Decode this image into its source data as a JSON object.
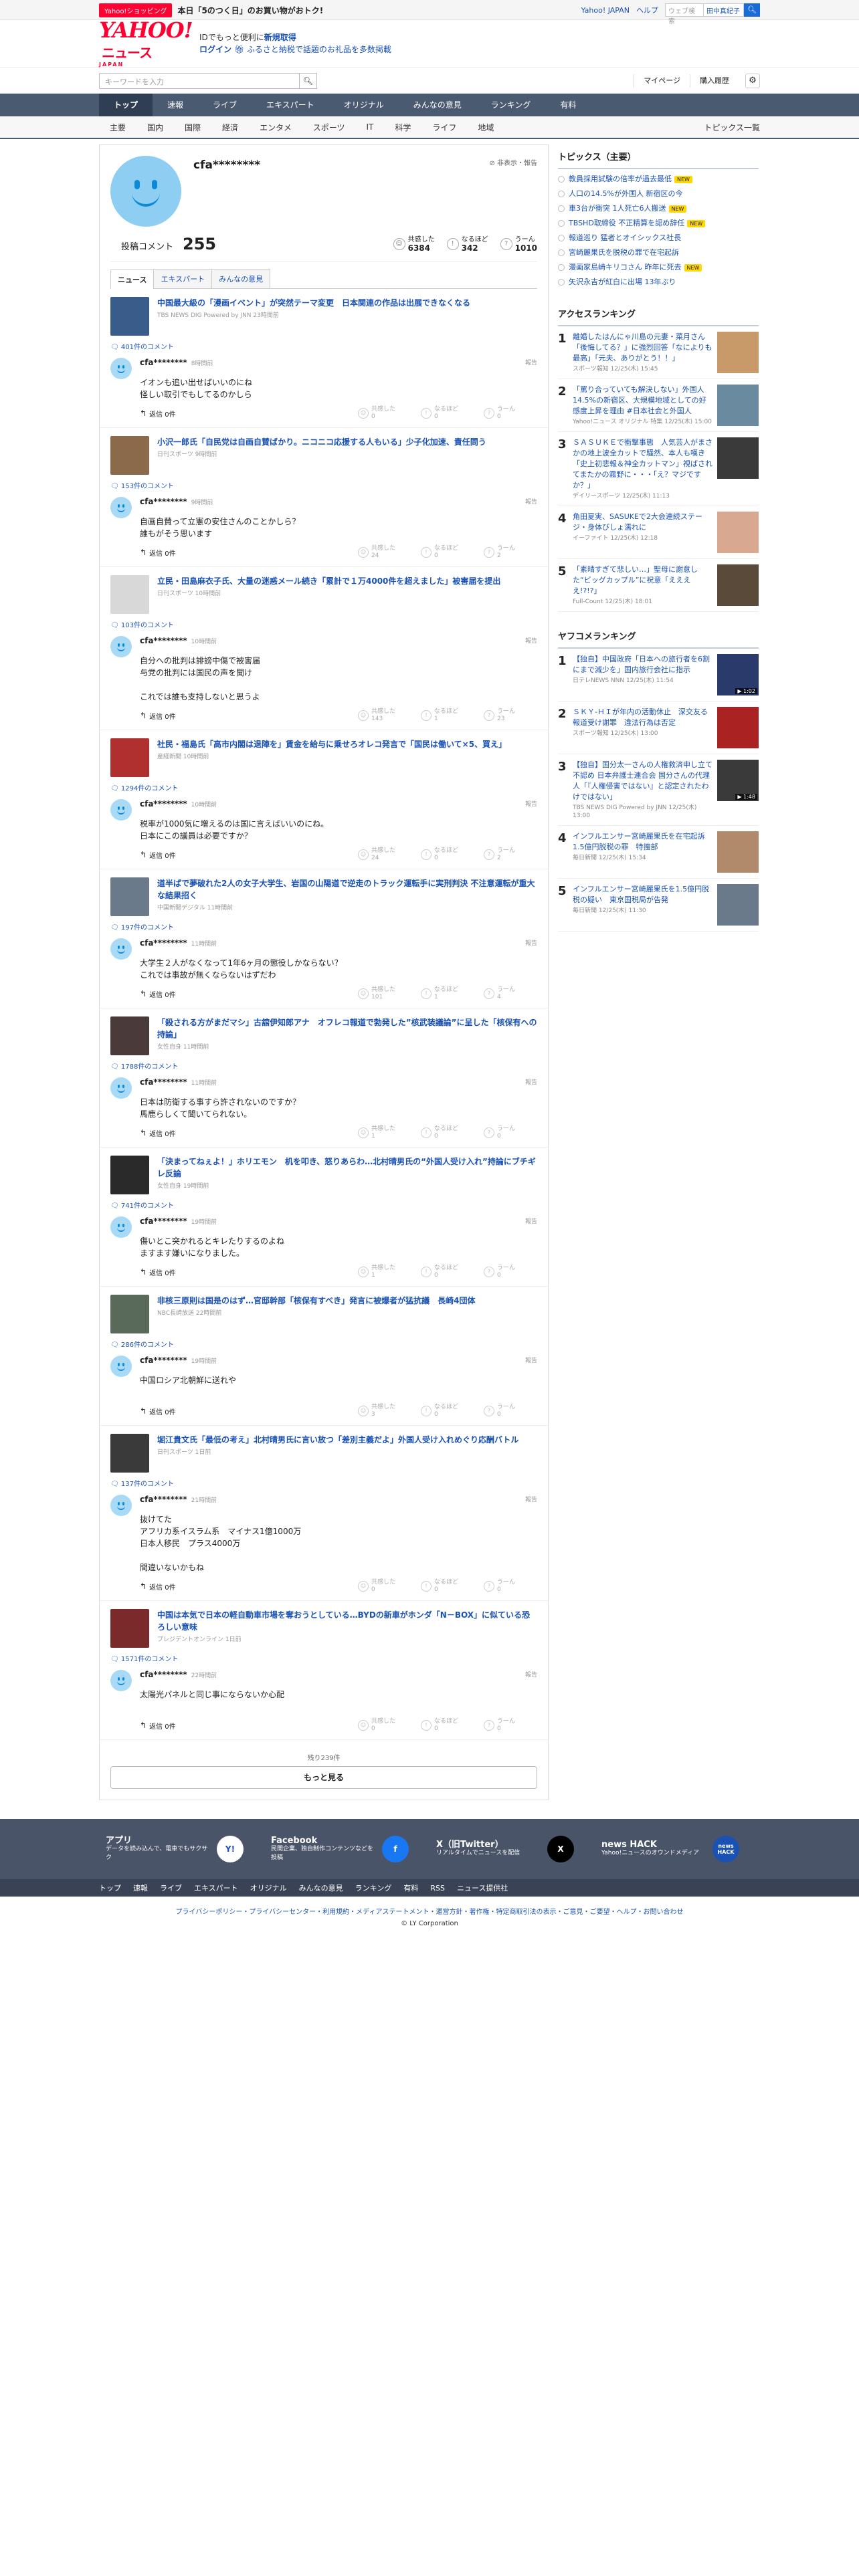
{
  "topbar": {
    "shop_badge": "Yahoo!ショッピング",
    "shop_text": "本日「5のつく日」のお買い物がおトク!",
    "links": [
      "Yahoo! JAPAN",
      "ヘルプ"
    ],
    "search_placeholder": "ウェブ検索",
    "user_name": "田中真紀子"
  },
  "header": {
    "logo": "YAHOO!",
    "logo_sub": "ニュース",
    "logo_jp": "JAPAN",
    "line1_prefix": "IDでもっと便利に",
    "line1_link": "新規取得",
    "line2_login": "ログイン",
    "line2_text": "ふるさと納税で話題のお礼品を多数掲載"
  },
  "searchrow": {
    "placeholder": "キーワードを入力",
    "mypage": "マイページ",
    "history": "購入履歴"
  },
  "nav1": [
    "トップ",
    "速報",
    "ライブ",
    "エキスパート",
    "オリジナル",
    "みんなの意見",
    "ランキング",
    "有料"
  ],
  "nav2": [
    "主要",
    "国内",
    "国際",
    "経済",
    "エンタメ",
    "スポーツ",
    "IT",
    "科学",
    "ライフ",
    "地域"
  ],
  "nav2_right": "トピックス一覧",
  "profile": {
    "name": "cfa********",
    "nonpublic": "非表示・報告",
    "label": "投稿コメント",
    "count": "255",
    "reactions": [
      {
        "icon": "thumb",
        "label": "共感した",
        "value": "6384"
      },
      {
        "icon": "lightbulb",
        "label": "なるほど",
        "value": "342"
      },
      {
        "icon": "hmm",
        "label": "うーん",
        "value": "1010"
      }
    ],
    "tabs": [
      "ニュース",
      "エキスパート",
      "みんなの意見"
    ]
  },
  "reply_label": "返信 0件",
  "report_label": "報告",
  "items": [
    {
      "title": "中国最大級の「漫画イベント」が突然テーマ変更　日本関連の作品は出展できなくなる",
      "source": "TBS NEWS DIG Powered by JNN 23時間前",
      "comments": "401件のコメント",
      "user": "cfa********",
      "time": "8時間前",
      "text": "イオンも追い出せばいいのにね\n怪しい取引でもしてるのかしら",
      "r": [
        "共感した\n0",
        "なるほど\n0",
        "うーん\n0"
      ],
      "thumb": "#3a5c8a"
    },
    {
      "title": "小沢一郎氏「自民党は自画自賛ばかり。ニコニコ応援する人もいる」少子化加速、責任問う",
      "source": "日刊スポーツ 9時間前",
      "comments": "153件のコメント",
      "user": "cfa********",
      "time": "9時間前",
      "text": "自画自賛って立憲の安住さんのことかしら？\n誰もがそう思います",
      "r": [
        "共感した\n24",
        "なるほど\n0",
        "うーん\n2"
      ],
      "thumb": "#8a6a4a"
    },
    {
      "title": "立民・田島麻衣子氏、大量の迷惑メール続き「累計で１万4000件を超えました」被害届を提出",
      "source": "日刊スポーツ 10時間前",
      "comments": "103件のコメント",
      "user": "cfa********",
      "time": "10時間前",
      "text": "自分への批判は誹謗中傷で被害届\n与党の批判には国民の声を聞け\n\nこれでは誰も支持しないと思うよ",
      "r": [
        "共感した\n143",
        "なるほど\n1",
        "うーん\n23"
      ],
      "thumb": "#d8d8d8"
    },
    {
      "title": "社民・福島氏「高市内閣は退陣を」賃金を給与に乗せろオレコ発言で「国民は働いて×5、買え」",
      "source": "産経新聞 10時間前",
      "comments": "1294件のコメント",
      "user": "cfa********",
      "time": "10時間前",
      "text": "税率が1000気に増えるのは国に言えばいいのにね。\n日本にこの議員は必要ですか？",
      "r": [
        "共感した\n24",
        "なるほど\n0",
        "うーん\n2"
      ],
      "thumb": "#b03030"
    },
    {
      "title": "道半ばで夢破れた2人の女子大学生、岩国の山陽道で逆走のトラック運転手に実刑判決 不注意運転が重大な結果招く",
      "source": "中国新聞デジタル 11時間前",
      "comments": "197件のコメント",
      "user": "cfa********",
      "time": "11時間前",
      "text": "大学生２人がなくなって1年6ヶ月の懲役しかならない？\nこれでは事故が無くならないはずだわ",
      "r": [
        "共感した\n101",
        "なるほど\n1",
        "うーん\n4"
      ],
      "thumb": "#6a7a8a"
    },
    {
      "title": "「殺される方がまだマシ」古舘伊知郎アナ　オフレコ報道で勃発した”核武装議論”に呈した「核保有への持論」",
      "source": "女性自身 11時間前",
      "comments": "1788件のコメント",
      "user": "cfa********",
      "time": "11時間前",
      "text": "日本は防衛する事すら許されないのですか？\n馬鹿らしくて聞いてられない。",
      "r": [
        "共感した\n1",
        "なるほど\n0",
        "うーん\n0"
      ],
      "thumb": "#4a3a3a"
    },
    {
      "title": "「決まってねぇよ！」ホリエモン　机を叩き、怒りあらわ…北村晴男氏の“外国人受け入れ”持論にブチギレ反論",
      "source": "女性自身 19時間前",
      "comments": "741件のコメント",
      "user": "cfa********",
      "time": "19時間前",
      "text": "傷いとこ突かれるとキレたりするのよね\nますます嫌いになりました。",
      "r": [
        "共感した\n1",
        "なるほど\n0",
        "うーん\n0"
      ],
      "thumb": "#2a2a2a"
    },
    {
      "title": "非核三原則は国是のはず…官邸幹部「核保有すべき」発言に被爆者が猛抗議　長崎4団体",
      "source": "NBC長崎放送 22時間前",
      "comments": "286件のコメント",
      "user": "cfa********",
      "time": "19時間前",
      "text": "中国ロシア北朝鮮に送れや",
      "r": [
        "共感した\n3",
        "なるほど\n0",
        "うーん\n0"
      ],
      "thumb": "#5a6a5a"
    },
    {
      "title": "堀江貴文氏「最低の考え」北村晴男氏に言い放つ「差別主義だよ」外国人受け入れめぐり応酬バトル",
      "source": "日刊スポーツ 1日前",
      "comments": "137件のコメント",
      "user": "cfa********",
      "time": "21時間前",
      "text": "抜けてた\nアフリカ系イスラム系　マイナス1億1000万\n日本人移民　プラス4000万\n\n間違いないかもね",
      "r": [
        "共感した\n0",
        "なるほど\n0",
        "うーん\n0"
      ],
      "thumb": "#3a3a3a"
    },
    {
      "title": "中国は本気で日本の軽自動車市場を奪おうとしている…BYDの新車がホンダ「N－BOX」に似ている恐ろしい意味",
      "source": "プレジデントオンライン 1日前",
      "comments": "1571件のコメント",
      "user": "cfa********",
      "time": "22時間前",
      "text": "太陽光パネルと同じ事にならないか心配",
      "r": [
        "共感した\n0",
        "なるほど\n0",
        "うーん\n0"
      ],
      "thumb": "#7a2a2a"
    }
  ],
  "remain": "残り239件",
  "more": "もっと見る",
  "right": {
    "topics_title": "トピックス（主要）",
    "topics": [
      {
        "t": "教員採用試験の倍率が過去最低",
        "new": true
      },
      {
        "t": "人口の14.5%が外国人 新宿区の今",
        "new": false
      },
      {
        "t": "車3台が衝突 1人死亡6人搬送",
        "new": true
      },
      {
        "t": "TBSHD取締役 不正精算を認め辞任",
        "new": true
      },
      {
        "t": "報道巡り 猛者とオイシックス社長",
        "new": false
      },
      {
        "t": "宮崎麗果氏を脱税の罪で在宅起訴",
        "new": false
      },
      {
        "t": "漫画家島崎キリコさん 昨年に死去",
        "new": true
      },
      {
        "t": "矢沢永吉が紅白に出場 13年ぶり",
        "new": false
      }
    ],
    "access_title": "アクセスランキング",
    "access": [
      {
        "n": "1",
        "t": "離婚したはんにゃ川島の元妻・菜月さん「後悔してる？」に強烈回答「なによりも最高」「元夫、ありがとう！！」",
        "s": "スポーツ報知 12/25(木) 15:45",
        "c": "#c89a6a"
      },
      {
        "n": "2",
        "t": "「罵り合っていても解決しない」外国人14.5%の新宿区、大規模地域としての好感度上昇を理由 #日本社会と外国人",
        "s": "Yahoo!ニュース オリジナル 特集 12/25(木) 15:00",
        "c": "#6a8aa0"
      },
      {
        "n": "3",
        "t": "ＳＡＳＵＫＥで衝撃事態　人気芸人がまさかの地上波全カットで騒然、本人も嘆き「史上初悲報＆神全カットマン」視ばされてまたかの霧野に・・・「え？マジですか？」",
        "s": "デイリースポーツ 12/25(木) 11:13",
        "c": "#3a3a3a"
      },
      {
        "n": "4",
        "t": "角田夏実、SASUKEで2大会連続ステージ・身体びしょ濡れに",
        "s": "イーファイト 12/25(木) 12:18",
        "c": "#d8a890"
      },
      {
        "n": "5",
        "t": "「素晴すぎて悲しい…」聖母に謝意した“ビッグカップル”に祝意「ええええ!?!?」",
        "s": "Full-Count 12/25(木) 18:01",
        "c": "#5a4a3a"
      }
    ],
    "yahoo_title": "ヤフコメランキング",
    "yahoo": [
      {
        "n": "1",
        "t": "【独自】中国政府「日本への旅行者を6割にまで減少を」国内旅行会社に指示",
        "s": "日テレNEWS NNN 12/25(木) 11:54",
        "c": "#2a3a6a",
        "v": "▶ 1:02"
      },
      {
        "n": "2",
        "t": "ＳＫＹ-ＨＩが年内の活動休止　深交友る報道受け謝罪　違法行為は否定",
        "s": "スポーツ報知 12/25(木) 13:00",
        "c": "#aa2222",
        "v": ""
      },
      {
        "n": "3",
        "t": "【独自】国分太一さんの人権救済申し立て不認め 日本弁護士連合会 国分さんの代理人「『人権侵害ではない』と認定されたわけではない」",
        "s": "TBS NEWS DIG Powered by JNN 12/25(木) 13:00",
        "c": "#3a3a3a",
        "v": "▶ 1:48"
      },
      {
        "n": "4",
        "t": "インフルエンサー宮崎麗果氏を在宅起訴　1.5億円脱税の罪　特捜部",
        "s": "毎日新聞 12/25(木) 15:34",
        "c": "#b08a6a",
        "v": ""
      },
      {
        "n": "5",
        "t": "インフルエンサー宮崎麗果氏を1.5億円脱税の疑い　東京国税局が告発",
        "s": "毎日新聞 12/25(木) 11:30",
        "c": "#6a7a8a",
        "v": ""
      }
    ]
  },
  "apps": [
    {
      "title": "アプリ",
      "desc": "データを読み込んで、電車でもサクサク",
      "logo": "Y!",
      "color": "#ffffff",
      "fg": "#1a52b4"
    },
    {
      "title": "Facebook",
      "desc": "民間企業、独自制作コンテンツなどを投稿",
      "logo": "f",
      "color": "#1877f2",
      "fg": "#ffffff"
    },
    {
      "title": "X（旧Twitter）",
      "desc": "リアルタイムでニュースを配信",
      "logo": "X",
      "color": "#000000",
      "fg": "#ffffff"
    },
    {
      "title": "news HACK",
      "desc": "Yahoo!ニュースのオウンドメディア",
      "logo": "news HACK",
      "color": "#1a52b4",
      "fg": "#ffffff"
    }
  ],
  "footnav": [
    "トップ",
    "速報",
    "ライブ",
    "エキスパート",
    "オリジナル",
    "みんなの意見",
    "ランキング",
    "有料",
    "RSS",
    "ニュース提供社"
  ],
  "footlinks": "プライバシーポリシー・プライバシーセンター・利用規約・メディアステートメント・運営方針・著作権・特定商取引法の表示・ご意見・ご要望・ヘルプ・お問い合わせ",
  "copyright": "© LY Corporation"
}
